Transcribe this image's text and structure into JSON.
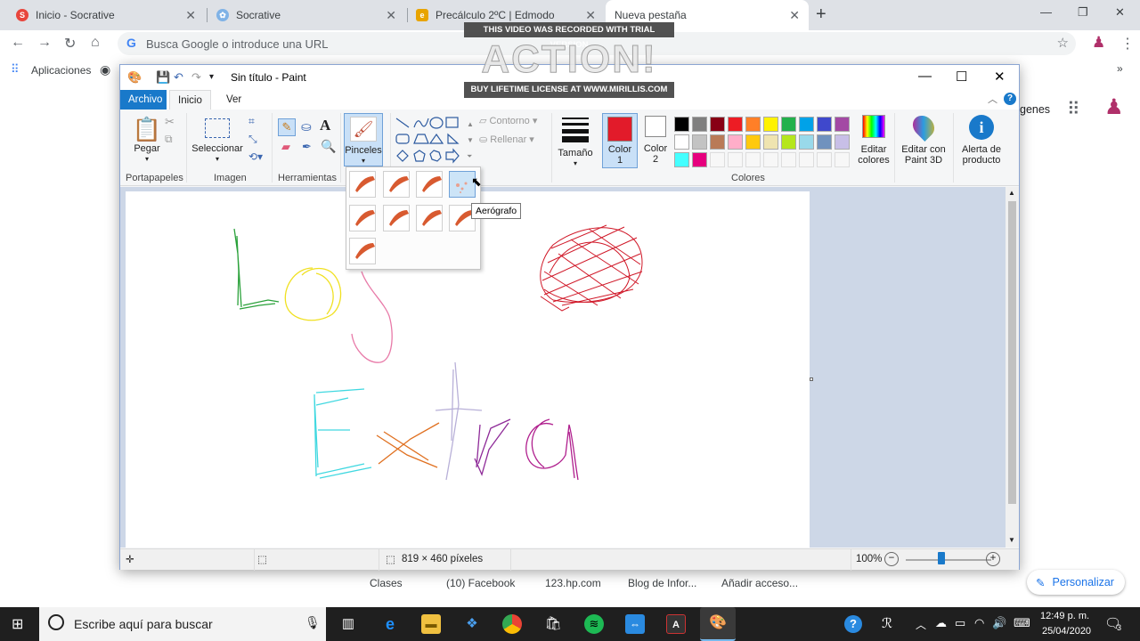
{
  "browser": {
    "tabs": [
      {
        "title": "Inicio - Socrative",
        "close": "✕"
      },
      {
        "title": "Socrative",
        "close": "✕"
      },
      {
        "title": "Precálculo 2ºC | Edmodo",
        "close": "✕"
      },
      {
        "title": "Nueva pestaña",
        "close": "✕"
      }
    ],
    "new_tab": "+",
    "omnibox_placeholder": "Busca Google o introduce una URL",
    "bookmarks": {
      "apps": "Aplicaciones"
    },
    "page_bookmarks": [
      "Clases",
      "(10) Facebook",
      "123.hp.com",
      "Blog de Infor...",
      "Añadir acceso..."
    ],
    "side_text": "genes",
    "personalize": "Personalizar"
  },
  "watermark": {
    "top": "THIS VIDEO WAS RECORDED WITH TRIAL VERSION",
    "logo": "ACTION!",
    "bottom": "BUY LIFETIME LICENSE AT WWW.MIRILLIS.COM"
  },
  "paint": {
    "title": "Sin título - Paint",
    "ribbon_tabs": [
      "Archivo",
      "Inicio",
      "Ver"
    ],
    "groups": {
      "clipboard": {
        "label": "Portapapeles",
        "paste": "Pegar"
      },
      "image": {
        "label": "Imagen",
        "select": "Seleccionar"
      },
      "tools": {
        "label": "Herramientas"
      },
      "brushes": {
        "label": "Pinceles"
      },
      "shapes": {
        "outline": "Contorno",
        "fill": "Rellenar"
      },
      "size": {
        "label": "Tamaño"
      },
      "color1": {
        "label1": "Color",
        "label2": "1",
        "value": "#e21b2a"
      },
      "color2": {
        "label1": "Color",
        "label2": "2",
        "value": "#ffffff"
      },
      "colors_label": "Colores",
      "edit_colors": [
        "Editar",
        "colores"
      ],
      "edit_3d": [
        "Editar con",
        "Paint 3D"
      ],
      "product_alert": [
        "Alerta de",
        "producto"
      ]
    },
    "palette": [
      "#000000",
      "#7f7f7f",
      "#880015",
      "#ed1c24",
      "#ff7f27",
      "#fff200",
      "#22b14c",
      "#00a2e8",
      "#3f48cc",
      "#a349a4",
      "#ffffff",
      "#c3c3c3",
      "#b97a57",
      "#ffaec9",
      "#ffc90e",
      "#efe4b0",
      "#b5e61d",
      "#99d9ea",
      "#7092be",
      "#c8bfe7",
      "#44ffff",
      "#e6007e"
    ],
    "tooltip": "Aerógrafo",
    "status": {
      "size": "819 × 460 píxeles",
      "zoom": "100%"
    }
  },
  "taskbar": {
    "search_placeholder": "Escribe aquí para buscar",
    "time": "12:49 p. m.",
    "date": "25/04/2020",
    "notif_count": "3"
  }
}
